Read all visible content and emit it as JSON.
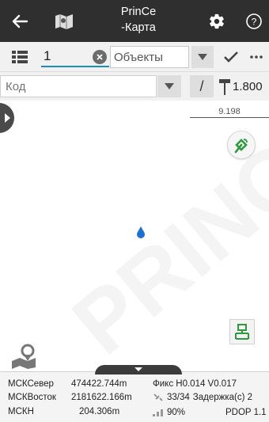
{
  "header": {
    "title_line1": "PrinCe",
    "title_line2": "-Карта"
  },
  "toolbar": {
    "point_name": "1",
    "object_select": "Объекты",
    "more_label": "···"
  },
  "code_row": {
    "code_placeholder": "Код",
    "slash_label": "/",
    "pole_height": "1.800"
  },
  "map": {
    "scale_value": "9.198",
    "watermark": "PRINCE"
  },
  "status": {
    "north_label": "МСКСевер",
    "north_value": "474422.744m",
    "east_label": "МСКВосток",
    "east_value": "2181622.166m",
    "height_label": "МСКН",
    "height_value": "204.306m",
    "fix_text": "Фикс H0.014 V0.017",
    "sats": "33/34",
    "delay_text": "Задержка(с) 2",
    "battery": "90%",
    "pdop": "PDOP 1.1"
  },
  "colors": {
    "header_bg": "#2f2f2f",
    "accent_blue": "#1e88c8",
    "rover_green": "#2e9a3e"
  }
}
